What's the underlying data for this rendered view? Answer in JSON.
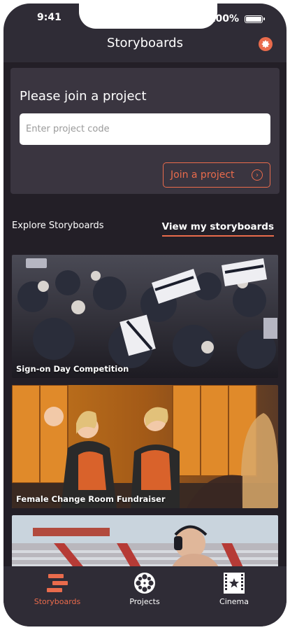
{
  "status": {
    "time": "9:41",
    "battery": "100%"
  },
  "header": {
    "title": "Storyboards",
    "settings_icon": "gear-icon"
  },
  "join": {
    "title": "Please join a project",
    "input_placeholder": "Enter project code",
    "input_value": "",
    "button_label": "Join a project",
    "button_icon": "arrow-right-circle-icon"
  },
  "explore": {
    "label": "Explore Storyboards",
    "view_link": "View my storyboards"
  },
  "stories": [
    {
      "caption": "Sign-on Day Competition"
    },
    {
      "caption": "Female Change Room Fundraiser"
    },
    {
      "caption": ""
    }
  ],
  "tabs": [
    {
      "label": "Storyboards",
      "icon": "storyboards-icon",
      "active": true
    },
    {
      "label": "Projects",
      "icon": "film-reel-icon",
      "active": false
    },
    {
      "label": "Cinema",
      "icon": "cinema-star-icon",
      "active": false
    }
  ],
  "colors": {
    "accent": "#e96b4c",
    "background": "#231f27",
    "card": "#3a3540",
    "bar": "#2f2c36"
  }
}
